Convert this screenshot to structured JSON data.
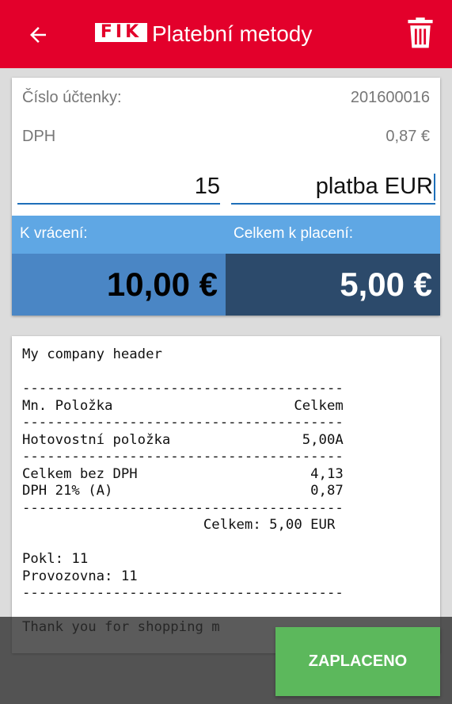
{
  "appbar": {
    "logo": "FIK",
    "title": "Platební metody",
    "back_icon": "arrow-left-icon",
    "delete_icon": "trash-icon"
  },
  "form": {
    "receipt_number_label": "Číslo účtenky:",
    "receipt_number_value": "201600016",
    "vat_label": "DPH",
    "vat_value": "0,87 €",
    "amount_input_value": "15",
    "method_input_value": "platba EUR",
    "change_label": "K vrácení:",
    "change_value": "10,00 €",
    "total_label": "Celkem k placení:",
    "total_value": "5,00 €"
  },
  "receipt": {
    "lines": [
      "My company header",
      "",
      "---------------------------------------",
      "Mn. Položka                      Celkem",
      "---------------------------------------",
      "Hotovostní položka                5,00A",
      "---------------------------------------",
      "Celkem bez DPH                     4,13",
      "DPH 21% (A)                        0,87",
      "---------------------------------------",
      "                      Celkem: 5,00 EUR",
      "",
      "Pokl: 11",
      "Provozovna: 11",
      "---------------------------------------",
      "",
      "Thank you for shopping m"
    ]
  },
  "actions": {
    "paid_button": "ZAPLACENO"
  },
  "colors": {
    "primary": "#e3002b",
    "band": "#5fa7e4",
    "change_bg": "#4a86c5",
    "total_bg": "#2c4a6b",
    "button": "#5cb85c"
  }
}
